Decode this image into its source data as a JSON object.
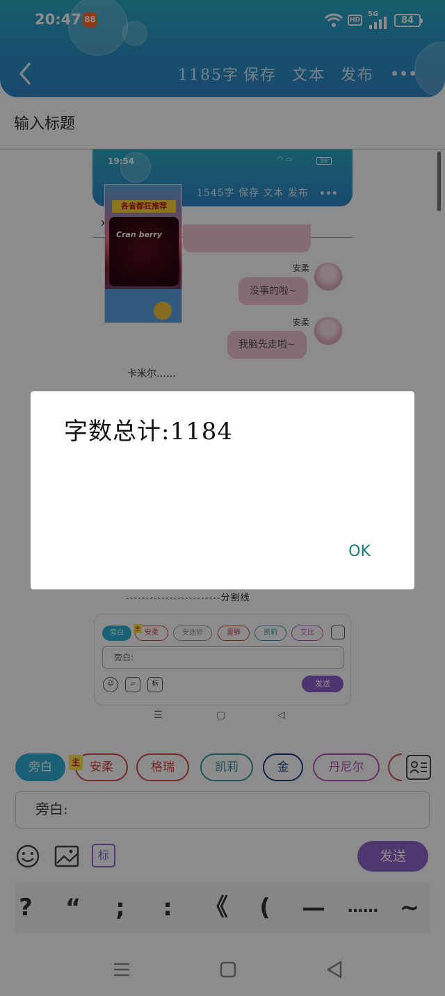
{
  "status_bar": {
    "time": "20:47",
    "network_label": "5G",
    "hd_label": "HD",
    "battery": "84"
  },
  "toolbar": {
    "word_count": "1185字",
    "save_label": "保存",
    "text_label": "文本",
    "publish_label": "发布"
  },
  "title_placeholder": "输入标题",
  "embedded_screenshot": {
    "time": "19:54",
    "battery": "99",
    "word_count": "1545字",
    "save_label": "保存",
    "text_label": "文本",
    "publish_label": "发布",
    "messages": [
      {
        "sender": "安柔",
        "text": "没事的啦~"
      },
      {
        "sender": "安柔",
        "text": "我脑先走啦~"
      }
    ],
    "narration": [
      "卡米尔……"
    ],
    "split_line": "------------------------分割线",
    "chips": [
      "旁白",
      "安柔",
      "安迷修",
      "雷狮",
      "凯莉",
      "艾比"
    ],
    "input_placeholder": "旁白:",
    "send_label": "发送",
    "tag_label": "标",
    "host_badge": "主"
  },
  "ad": {
    "headline": "各省都狂推荐",
    "brand": "Cran berry"
  },
  "dialog": {
    "message": "字数总计:1184",
    "ok_label": "OK"
  },
  "composer": {
    "host_badge": "主",
    "chips": [
      {
        "label": "旁白",
        "color": "#2eb0d3"
      },
      {
        "label": "安柔",
        "color": "#d84a4a"
      },
      {
        "label": "格瑞",
        "color": "#d84a4a"
      },
      {
        "label": "凯莉",
        "color": "#3b9ca4"
      },
      {
        "label": "金",
        "color": "#1f3f86"
      },
      {
        "label": "丹尼尔",
        "color": "#c055b8"
      }
    ],
    "input_placeholder": "旁白:",
    "tag_label": "标",
    "send_label": "发送",
    "punctuation": [
      "?",
      "“",
      ";",
      ":",
      "《",
      "(",
      "—",
      "……",
      "~"
    ]
  }
}
